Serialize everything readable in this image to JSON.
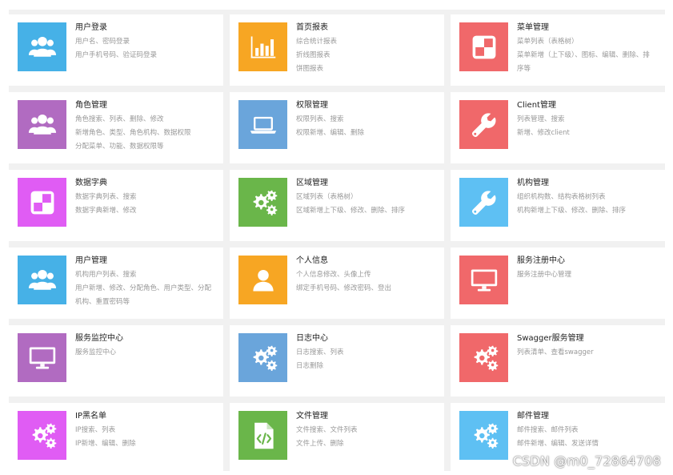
{
  "colors": {
    "blue": "#46b1e7",
    "orange": "#f7a623",
    "red": "#f0686a",
    "purple": "#b16bc1",
    "steelblue": "#6aa5db",
    "magenta": "#e05cf4",
    "green": "#6ab64a",
    "skyblue": "#5ec0f3"
  },
  "cards": [
    {
      "title": "用户登录",
      "lines": [
        "用户名、密码登录",
        "用户手机号码、验证码登录"
      ],
      "icon": "users-icon",
      "color": "#46b1e7"
    },
    {
      "title": "首页报表",
      "lines": [
        "综合统计报表",
        "折线图报表",
        "饼图报表"
      ],
      "icon": "bar-chart-icon",
      "color": "#f7a623"
    },
    {
      "title": "菜单管理",
      "lines": [
        "菜单列表（表格树）",
        "菜单新增（上下级）、图标、编辑、删除、排",
        "序等"
      ],
      "icon": "menu-grid-icon",
      "color": "#f0686a"
    },
    {
      "title": "角色管理",
      "lines": [
        "角色搜索、列表、删除、修改",
        "新增角色、类型、角色机构、数据权限",
        "分配菜单、功能、数据权限等"
      ],
      "icon": "users-icon",
      "color": "#b16bc1"
    },
    {
      "title": "权限管理",
      "lines": [
        "权限列表、搜索",
        "权限新增、编辑、删除"
      ],
      "icon": "laptop-icon",
      "color": "#6aa5db"
    },
    {
      "title": "Client管理",
      "lines": [
        "列表管理、搜索",
        "新增、修改client"
      ],
      "icon": "wrench-icon",
      "color": "#f0686a"
    },
    {
      "title": "数据字典",
      "lines": [
        "数据字典列表、搜索",
        "数据字典新增、修改"
      ],
      "icon": "menu-grid-icon",
      "color": "#e05cf4"
    },
    {
      "title": "区域管理",
      "lines": [
        "区域列表（表格树）",
        "区域新增上下级、修改、删除、排序"
      ],
      "icon": "gears-icon",
      "color": "#6ab64a"
    },
    {
      "title": "机构管理",
      "lines": [
        "组织机构数、结构表格树列表",
        "机构新增上下级、修改、删除、排序"
      ],
      "icon": "wrench-icon",
      "color": "#5ec0f3"
    },
    {
      "title": "用户管理",
      "lines": [
        "机构用户列表、搜索",
        "用户新增、修改、分配角色、用户类型、分配",
        "机构、重置密码等"
      ],
      "icon": "users-icon",
      "color": "#46b1e7"
    },
    {
      "title": "个人信息",
      "lines": [
        "个人信息修改、头像上传",
        "绑定手机号码、修改密码、登出"
      ],
      "icon": "user-icon",
      "color": "#f7a623"
    },
    {
      "title": "服务注册中心",
      "lines": [
        "服务注册中心管理"
      ],
      "icon": "monitor-icon",
      "color": "#f0686a"
    },
    {
      "title": "服务监控中心",
      "lines": [
        "服务监控中心"
      ],
      "icon": "monitor-icon",
      "color": "#b16bc1"
    },
    {
      "title": "日志中心",
      "lines": [
        "日志搜索、列表",
        "日志删除"
      ],
      "icon": "gears-icon",
      "color": "#6aa5db"
    },
    {
      "title": "Swagger服务管理",
      "lines": [
        "列表清单、查看swagger"
      ],
      "icon": "gears-icon",
      "color": "#f0686a"
    },
    {
      "title": "IP黑名单",
      "lines": [
        "IP搜索、列表",
        "IP新增、编辑、删除"
      ],
      "icon": "gears-icon",
      "color": "#e05cf4"
    },
    {
      "title": "文件管理",
      "lines": [
        "文件搜索、文件列表",
        "文件上传、删除"
      ],
      "icon": "code-file-icon",
      "color": "#6ab64a"
    },
    {
      "title": "邮件管理",
      "lines": [
        "邮件搜索、邮件列表",
        "邮件新增、编辑、发送详情"
      ],
      "icon": "gears-icon",
      "color": "#5ec0f3"
    }
  ],
  "watermark": "CSDN @m0_72864708"
}
